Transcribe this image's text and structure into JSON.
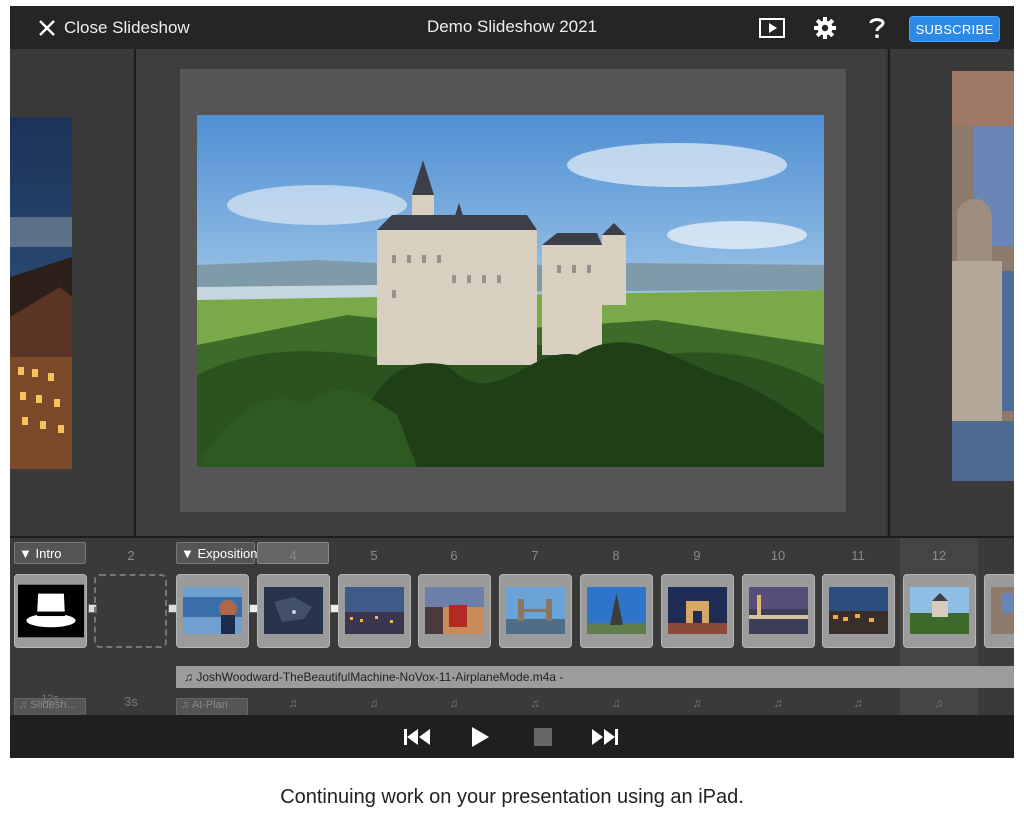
{
  "header": {
    "close_label": "Close Slideshow",
    "title": "Demo Slideshow 2021",
    "subscribe_label": "SUBSCRIBE"
  },
  "icons": {
    "close": "close-icon",
    "play_preview": "play-preview-icon",
    "settings": "gear-icon",
    "help": "help-icon",
    "skip_back": "skip-back-icon",
    "play": "play-icon",
    "stop": "stop-icon",
    "skip_forward": "skip-forward-icon",
    "music_note": "music-note-icon"
  },
  "timeline": {
    "chapters": [
      {
        "label": "Intro"
      },
      {
        "label": "Exposition"
      }
    ],
    "slide_numbers": [
      "2",
      "4",
      "5",
      "6",
      "7",
      "8",
      "9",
      "10",
      "11",
      "12"
    ],
    "audio_track": "♫ JoshWoodward-TheBeautifulMachine-NoVox-11-AirplaneMode.m4a -",
    "durations": {
      "intro_duration": "12s",
      "slide2_duration": "3s"
    },
    "track_labels": {
      "intro_track": "♫ Slidesh…",
      "exposition_track": "♫ At-Plan"
    },
    "note_glyph": "♫"
  },
  "caption": "Continuing work on your presentation using an iPad.",
  "colors": {
    "accent": "#2b8ae6",
    "topbar": "#252525",
    "background": "#333333"
  }
}
